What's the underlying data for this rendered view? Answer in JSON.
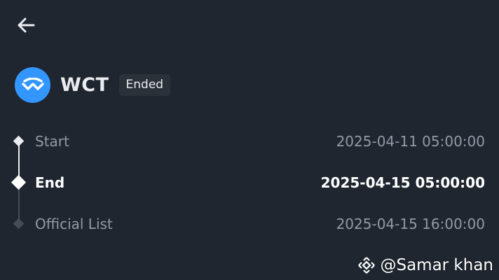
{
  "header": {
    "back_icon": "arrow-left-icon"
  },
  "token": {
    "name": "WCT",
    "status": "Ended",
    "logo_icon": "walletconnect-logo-icon",
    "logo_color": "#3396FF"
  },
  "timeline": [
    {
      "label": "Start",
      "time": "2025-04-11 05:00:00",
      "state": "past"
    },
    {
      "label": "End",
      "time": "2025-04-15 05:00:00",
      "state": "current"
    },
    {
      "label": "Official List",
      "time": "2025-04-15 16:00:00",
      "state": "future"
    }
  ],
  "watermark": {
    "text": "@Samar khan",
    "icon": "binance-logo-icon"
  }
}
